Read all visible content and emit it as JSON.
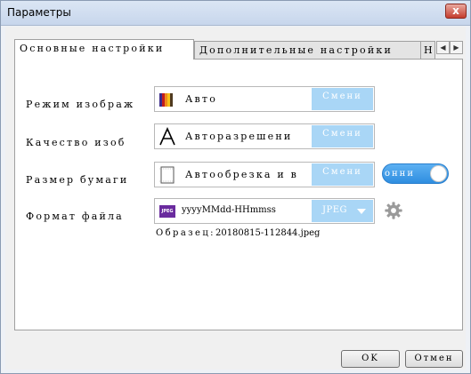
{
  "window": {
    "title": "Параметры",
    "close_label": "x"
  },
  "tabs": [
    {
      "label": "Основные настройки",
      "active": true
    },
    {
      "label": "Дополнительные настройки",
      "active": false
    },
    {
      "label": "Н",
      "active": false
    }
  ],
  "tab_scroll": {
    "left_glyph": "◀",
    "right_glyph": "▶"
  },
  "settings": {
    "image_mode": {
      "label": "Режим изображ",
      "value": "Авто",
      "button": "Смени"
    },
    "quality": {
      "label": "Качество изоб",
      "value": "Авторазрешени",
      "button": "Смени"
    },
    "paper_size": {
      "label": "Размер бумаги",
      "value": "Автообрезка и в",
      "button": "Смени",
      "toggle_text": "онни"
    },
    "file_format": {
      "label": "Формат файла",
      "value": "yyyyMMdd-HHmmss",
      "format_button": "JPEG",
      "icon_text": "JPEG",
      "sample_label": "Образец:",
      "sample_value": "20180815-112844.jpeg"
    }
  },
  "buttons": {
    "ok": "OK",
    "cancel": "Отмен"
  },
  "colors": {
    "accent_button": "#a9d6f6",
    "toggle": "#2f8ee0",
    "jpeg_icon": "#6a2b9e",
    "close_button": "#c43c2d"
  },
  "icons": {
    "image_mode": "color-bars-icon",
    "quality": "letter-a-icon",
    "paper_size": "page-outline-icon",
    "file_format": "jpeg-file-icon",
    "settings": "gear-icon"
  }
}
